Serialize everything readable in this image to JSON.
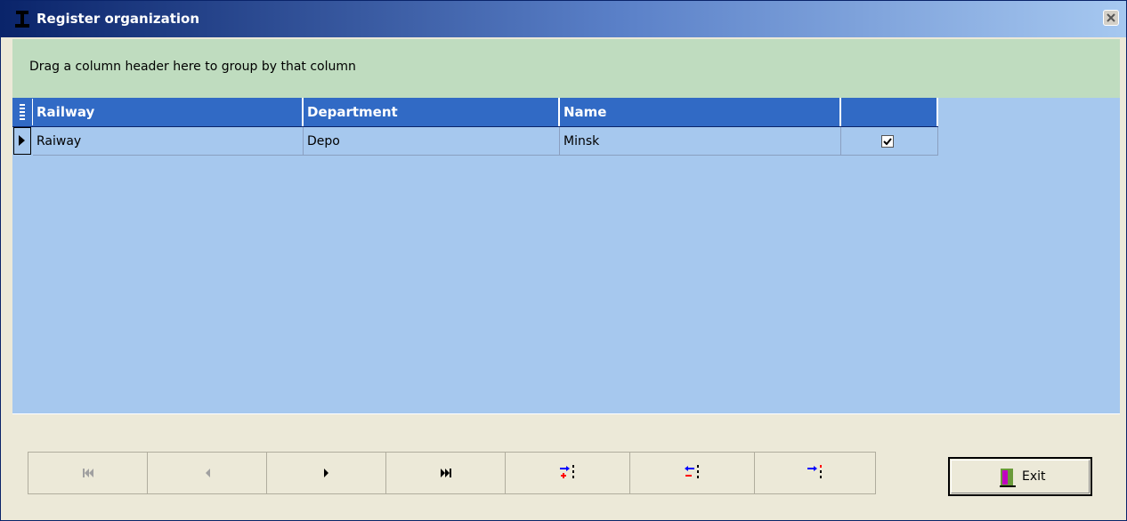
{
  "window": {
    "title": "Register organization"
  },
  "group_panel": {
    "hint": "Drag a column header here to group by that column"
  },
  "grid": {
    "columns": [
      "Railway",
      "Department",
      "Name",
      ""
    ],
    "rows": [
      {
        "railway": "Raiway",
        "department": "Depo",
        "name": "Minsk",
        "checked": true
      }
    ]
  },
  "navigator": {
    "buttons": [
      "first-icon",
      "prior-icon",
      "next-icon",
      "last-icon",
      "insert-icon",
      "delete-icon",
      "post-icon"
    ]
  },
  "exit": {
    "label": "Exit"
  },
  "colors": {
    "header_bg": "#316ac5",
    "grid_bg": "#a6c8ee",
    "group_bg": "#bfdcbf",
    "window_bg": "#ece9d8"
  }
}
